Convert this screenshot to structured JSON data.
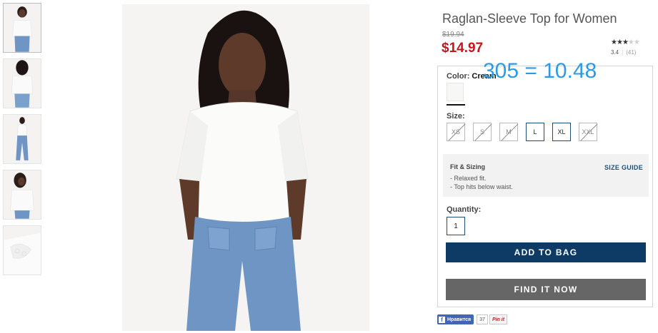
{
  "product": {
    "title": "Raglan-Sleeve Top for Women",
    "price_old": "$19.94",
    "price_sale": "$14.97"
  },
  "rating": {
    "value": "3.4",
    "stars_filled": 3.4,
    "stars_total": 5,
    "count": "(41)"
  },
  "overlay_annotation": "305 = 10.48",
  "color": {
    "label": "Color:",
    "value": "Cream",
    "swatch_hex": "#f7f7f5"
  },
  "size": {
    "label": "Size:",
    "options": [
      {
        "label": "XS",
        "available": false
      },
      {
        "label": "S",
        "available": false
      },
      {
        "label": "M",
        "available": false
      },
      {
        "label": "L",
        "available": true
      },
      {
        "label": "XL",
        "available": true
      },
      {
        "label": "XXL",
        "available": false
      }
    ]
  },
  "fit": {
    "title": "Fit & Sizing",
    "guide_link": "SIZE GUIDE",
    "bullets": [
      "- Relaxed fit.",
      "- Top hits below waist."
    ]
  },
  "quantity": {
    "label": "Quantity:",
    "value": "1"
  },
  "buttons": {
    "add_to_bag": "ADD TO BAG",
    "find_it_now": "FIND IT NOW"
  },
  "social": {
    "facebook_label": "Нравится",
    "facebook_count": "37",
    "pinterest_label": "Pin it"
  },
  "colors": {
    "brand_navy": "#0d3b66",
    "sale_red": "#c4161c",
    "find_gray": "#666666",
    "annotation_blue": "#2b9be8"
  },
  "thumbnails": [
    {
      "name": "front-view",
      "active": true
    },
    {
      "name": "back-view",
      "active": false
    },
    {
      "name": "full-body-view",
      "active": false
    },
    {
      "name": "side-view",
      "active": false
    },
    {
      "name": "sleeve-detail-view",
      "active": false
    }
  ]
}
